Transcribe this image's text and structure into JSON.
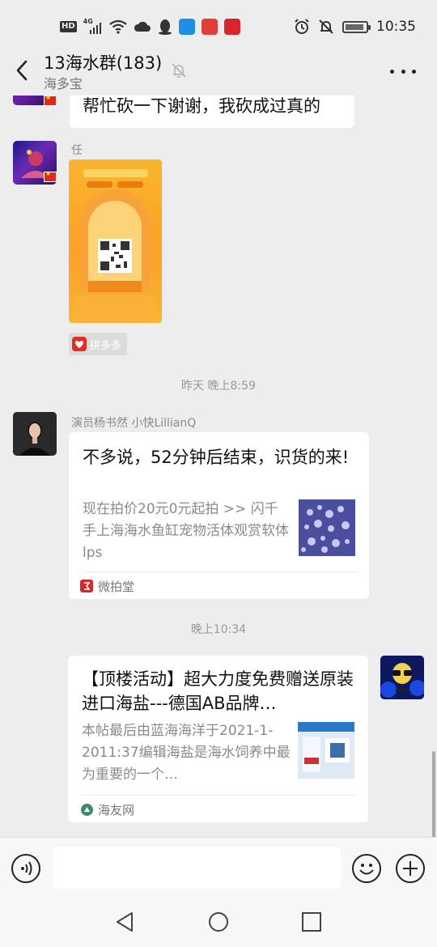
{
  "status_bar": {
    "hd": "HD",
    "network": "4G",
    "time": "10:35"
  },
  "nav": {
    "title": "13海水群(183)",
    "subtitle": "海多宝"
  },
  "messages": {
    "m1_text": "帮忙砍一下谢谢，我砍成过真的",
    "m2_sender": "任",
    "m2_source": "拼多多",
    "ts1": "昨天 晚上8:59",
    "m3_sender": "演员杨书然 小快LillianQ",
    "m3_title": "不多说，52分钟后结束，识货的来!",
    "m3_desc": "现在拍价20元0元起拍 >> 闪千手上海海水鱼缸宠物活体观赏软体lps",
    "m3_source": "微拍堂",
    "ts2": "晚上10:34",
    "m4_title": "【顶楼活动】超大力度免费赠送原装进口海盐---德国AB品牌…",
    "m4_desc": "本帖最后由蓝海海洋于2021-1-2011:37编辑海盐是海水饲养中最为重要的一个…",
    "m4_source": "海友网"
  },
  "icons": {
    "back": "back-arrow-icon",
    "mute": "bell-mute-icon",
    "more": "more-icon",
    "voice": "voice-icon",
    "emoji": "emoji-icon",
    "plus": "plus-icon"
  },
  "colors": {
    "background": "#ededed",
    "bubble": "#ffffff",
    "pdd_red": "#e02e24",
    "wpt_red": "#d7262c",
    "haiyou_green": "#3b8a6a"
  }
}
